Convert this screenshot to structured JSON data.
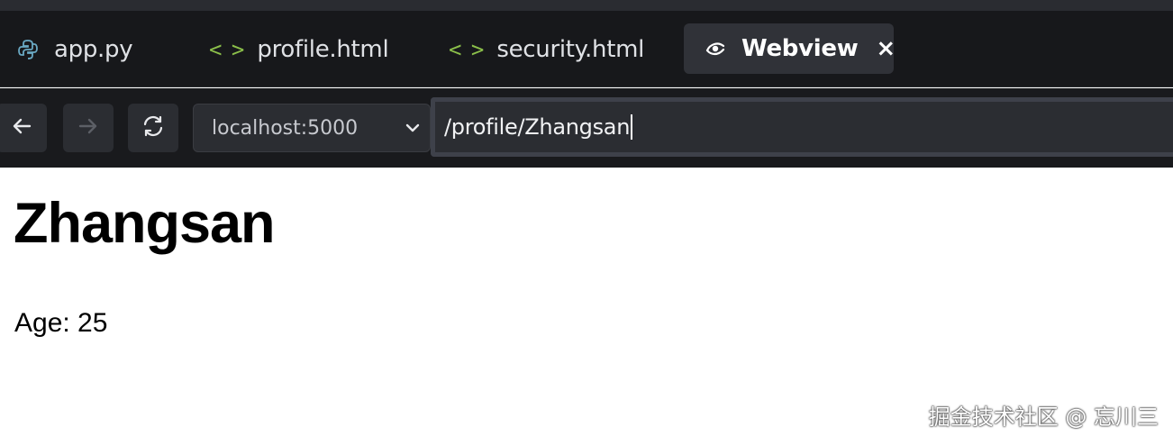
{
  "tabs": [
    {
      "label": "app.py",
      "icon": "python-icon",
      "active": false
    },
    {
      "label": "profile.html",
      "icon": "code-icon",
      "active": false
    },
    {
      "label": "security.html",
      "icon": "code-icon",
      "active": false
    },
    {
      "label": "Webview",
      "icon": "webview-eye-icon",
      "active": true,
      "close_glyph": "×"
    }
  ],
  "toolbar": {
    "back_icon": "arrow-left-icon",
    "forward_icon": "arrow-right-icon",
    "reload_icon": "reload-icon",
    "host": "localhost:5000",
    "url_path": "/profile/Zhangsan"
  },
  "page": {
    "title": "Zhangsan",
    "age_text": "Age: 25"
  },
  "watermark": "掘金技术社区 @ 忘川三",
  "colors": {
    "tab_bar_bg": "#17181b",
    "active_tab_bg": "#303238",
    "nav_button_bg": "#2b2d32",
    "code_icon_green": "#8bbf4a",
    "python_icon": "#6aa9c4"
  }
}
